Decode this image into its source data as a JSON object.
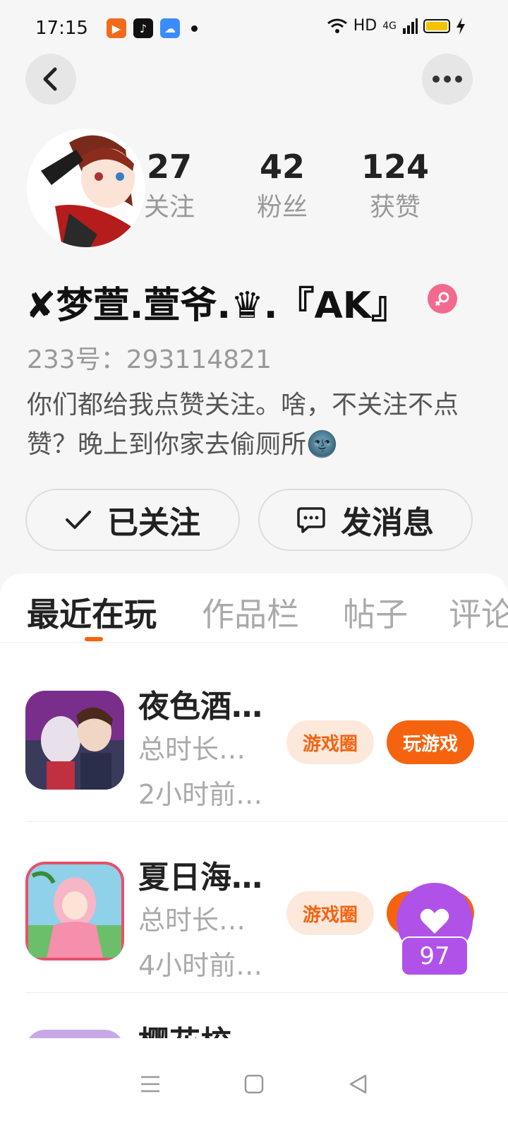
{
  "status_bar": {
    "time": "17:15",
    "network": "HD",
    "signal": "4G",
    "notification_icons": [
      "kuaishou-icon",
      "tiktok-icon",
      "cloud-app-icon"
    ]
  },
  "profile": {
    "stats": [
      {
        "value": "27",
        "label": "关注"
      },
      {
        "value": "42",
        "label": "粉丝"
      },
      {
        "value": "124",
        "label": "获赞"
      }
    ],
    "nickname": "✘梦萱.萱爷.♛.『AK』",
    "user_id": "233号：293114821",
    "bio": "你们都给我点赞关注。啥，不关注不点赞？晚上到你家去偷厕所🌚",
    "follow_label": "已关注",
    "message_label": "发消息"
  },
  "tabs": [
    "最近在玩",
    "作品栏",
    "帖子",
    "评论"
  ],
  "games": [
    {
      "title": "夜色酒…",
      "duration": "总时长…",
      "last_played": "2小时前…",
      "circle_label": "游戏圈",
      "play_label": "玩游戏"
    },
    {
      "title": "夏日海…",
      "duration": "总时长…",
      "last_played": "4小时前…",
      "circle_label": "游戏圈",
      "play_label": "玩游戏"
    },
    {
      "title": "樱花校"
    }
  ],
  "like_float": {
    "count": "97"
  },
  "colors": {
    "accent": "#f5630f",
    "accent_light": "#fde8dc",
    "like_purple": "#b052e8",
    "gender_pink": "#f26a8d"
  }
}
